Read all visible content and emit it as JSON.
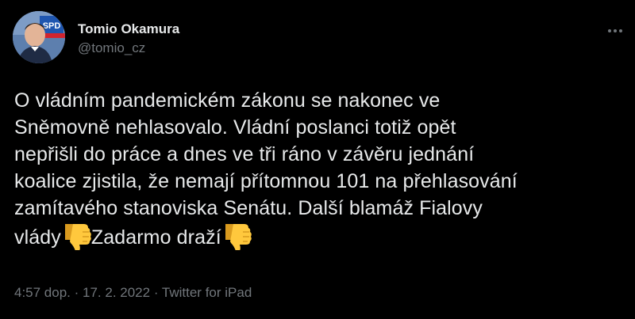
{
  "author": {
    "display_name": "Tomio Okamura",
    "handle": "@tomio_cz",
    "avatar_badge": "SPD"
  },
  "tweet": {
    "text_part1": "O vládním pandemickém zákonu se nakonec ve Sněmovně nehlasovalo. Vládní poslanci totiž opět nepřišli do práce a dnes ve tři ráno v závěru jednání koalice zjistila, že nemají přítomnou 101 na přehlasování zamítavého stanoviska Senátu. Další blamáž Fialovy vlády",
    "text_part2": "Zadarmo draží",
    "emoji_1": "thumbs-down",
    "emoji_2": "thumbs-down"
  },
  "meta": {
    "time": "4:57 dop.",
    "separator_1": " · ",
    "date": "17. 2. 2022",
    "separator_2": " · ",
    "source": "Twitter for iPad"
  },
  "colors": {
    "background": "#000000",
    "text": "#e7e9ea",
    "secondary_text": "#71767b",
    "emoji_yellow": "#ffc83d"
  }
}
